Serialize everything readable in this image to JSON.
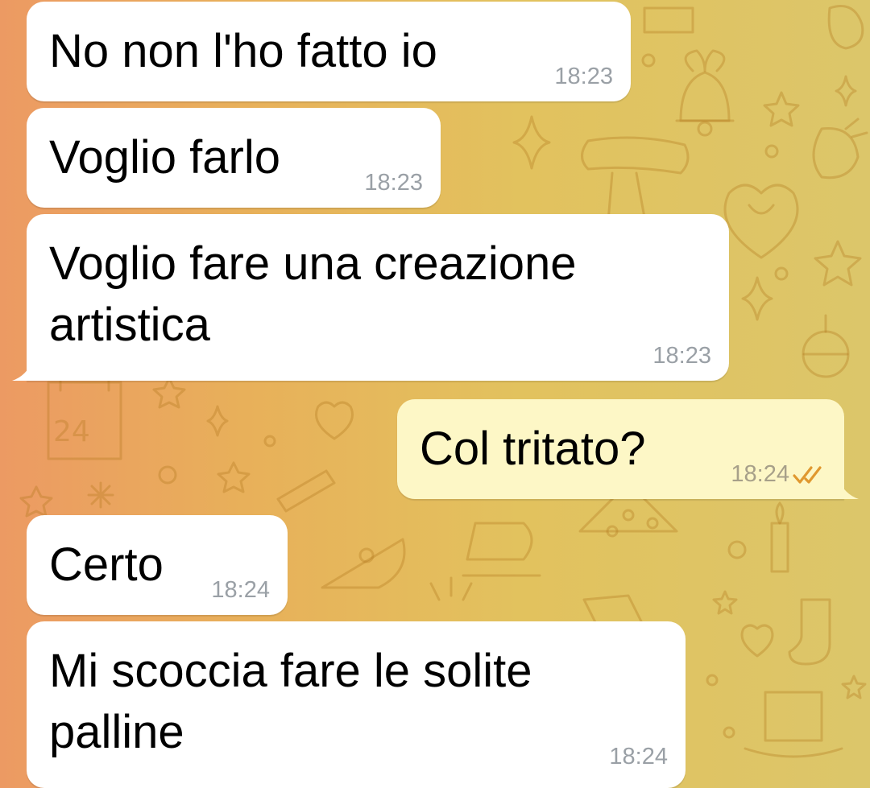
{
  "messages": [
    {
      "text": "No non l'ho fatto io",
      "time": "18:23",
      "direction": "incoming"
    },
    {
      "text": "Voglio farlo",
      "time": "18:23",
      "direction": "incoming"
    },
    {
      "line1": "Voglio fare una creazione",
      "line2": "artistica",
      "time": "18:23",
      "direction": "incoming"
    },
    {
      "text": "Col tritato?",
      "time": "18:24",
      "direction": "outgoing",
      "status": "read-double-check-icon"
    },
    {
      "text": "Certo",
      "time": "18:24",
      "direction": "incoming"
    },
    {
      "line1": "Mi scoccia fare le solite",
      "line2": "palline",
      "time": "18:24",
      "direction": "incoming"
    }
  ],
  "calendar_doodle_number": "24",
  "colors": {
    "incoming_bubble": "#ffffff",
    "outgoing_bubble": "#fdf7c6",
    "timestamp": "#9aa0a6",
    "read_ticks": "#e0982f"
  }
}
